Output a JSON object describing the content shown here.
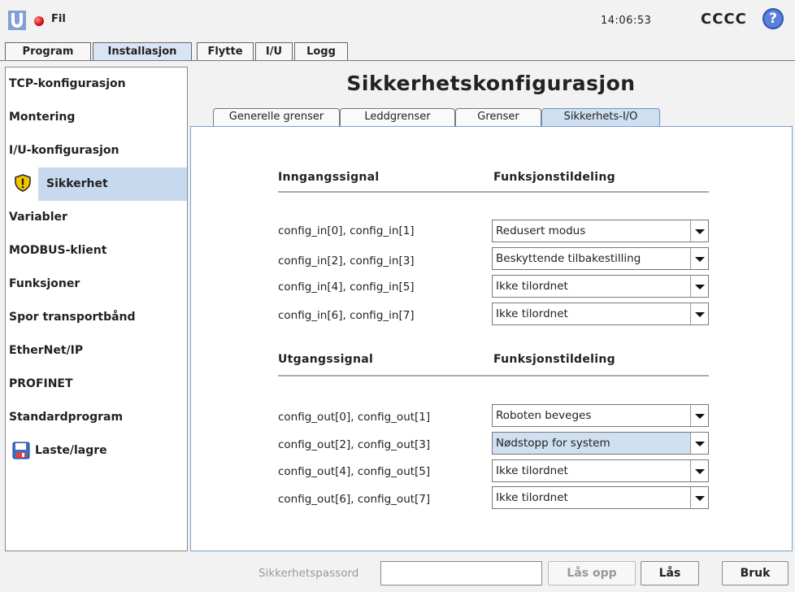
{
  "header": {
    "file_menu": "Fil",
    "clock": "14:06:53",
    "robot_name": "CCCC",
    "help_symbol": "?"
  },
  "main_tabs": [
    "Program",
    "Installasjon",
    "Flytte",
    "I/U",
    "Logg"
  ],
  "sidebar": {
    "items": [
      "TCP-konfigurasjon",
      "Montering",
      "I/U-konfigurasjon",
      "Sikkerhet",
      "Variabler",
      "MODBUS-klient",
      "Funksjoner",
      "Spor transportbånd",
      "EtherNet/IP",
      "PROFINET",
      "Standardprogram",
      "Laste/lagre"
    ]
  },
  "content": {
    "title": "Sikkerhetskonfigurasjon",
    "sub_tabs": [
      "Generelle grenser",
      "Leddgrenser",
      "Grenser",
      "Sikkerhets-I/O"
    ],
    "inputs": {
      "header_signal": "Inngangssignal",
      "header_function": "Funksjonstildeling",
      "rows": [
        {
          "label": "config_in[0], config_in[1]",
          "value": "Redusert modus"
        },
        {
          "label": "config_in[2], config_in[3]",
          "value": "Beskyttende tilbakestilling"
        },
        {
          "label": "config_in[4], config_in[5]",
          "value": "Ikke tilordnet"
        },
        {
          "label": "config_in[6], config_in[7]",
          "value": "Ikke tilordnet"
        }
      ]
    },
    "outputs": {
      "header_signal": "Utgangssignal",
      "header_function": "Funksjonstildeling",
      "rows": [
        {
          "label": "config_out[0], config_out[1]",
          "value": "Roboten beveges"
        },
        {
          "label": "config_out[2], config_out[3]",
          "value": "Nødstopp for system"
        },
        {
          "label": "config_out[4], config_out[5]",
          "value": "Ikke tilordnet"
        },
        {
          "label": "config_out[6], config_out[7]",
          "value": "Ikke tilordnet"
        }
      ]
    }
  },
  "footer": {
    "password_label": "Sikkerhetspassord",
    "password_value": "",
    "unlock_label": "Lås opp",
    "lock_label": "Lås",
    "apply_label": "Bruk"
  },
  "colors": {
    "active_tab": "#d9e5f4",
    "selected_sidebar": "#c7d9ee",
    "panel_border": "#7a9fcc",
    "status_dot": "#d01010",
    "help": "#5a80d8",
    "warning": "#f5c400"
  }
}
